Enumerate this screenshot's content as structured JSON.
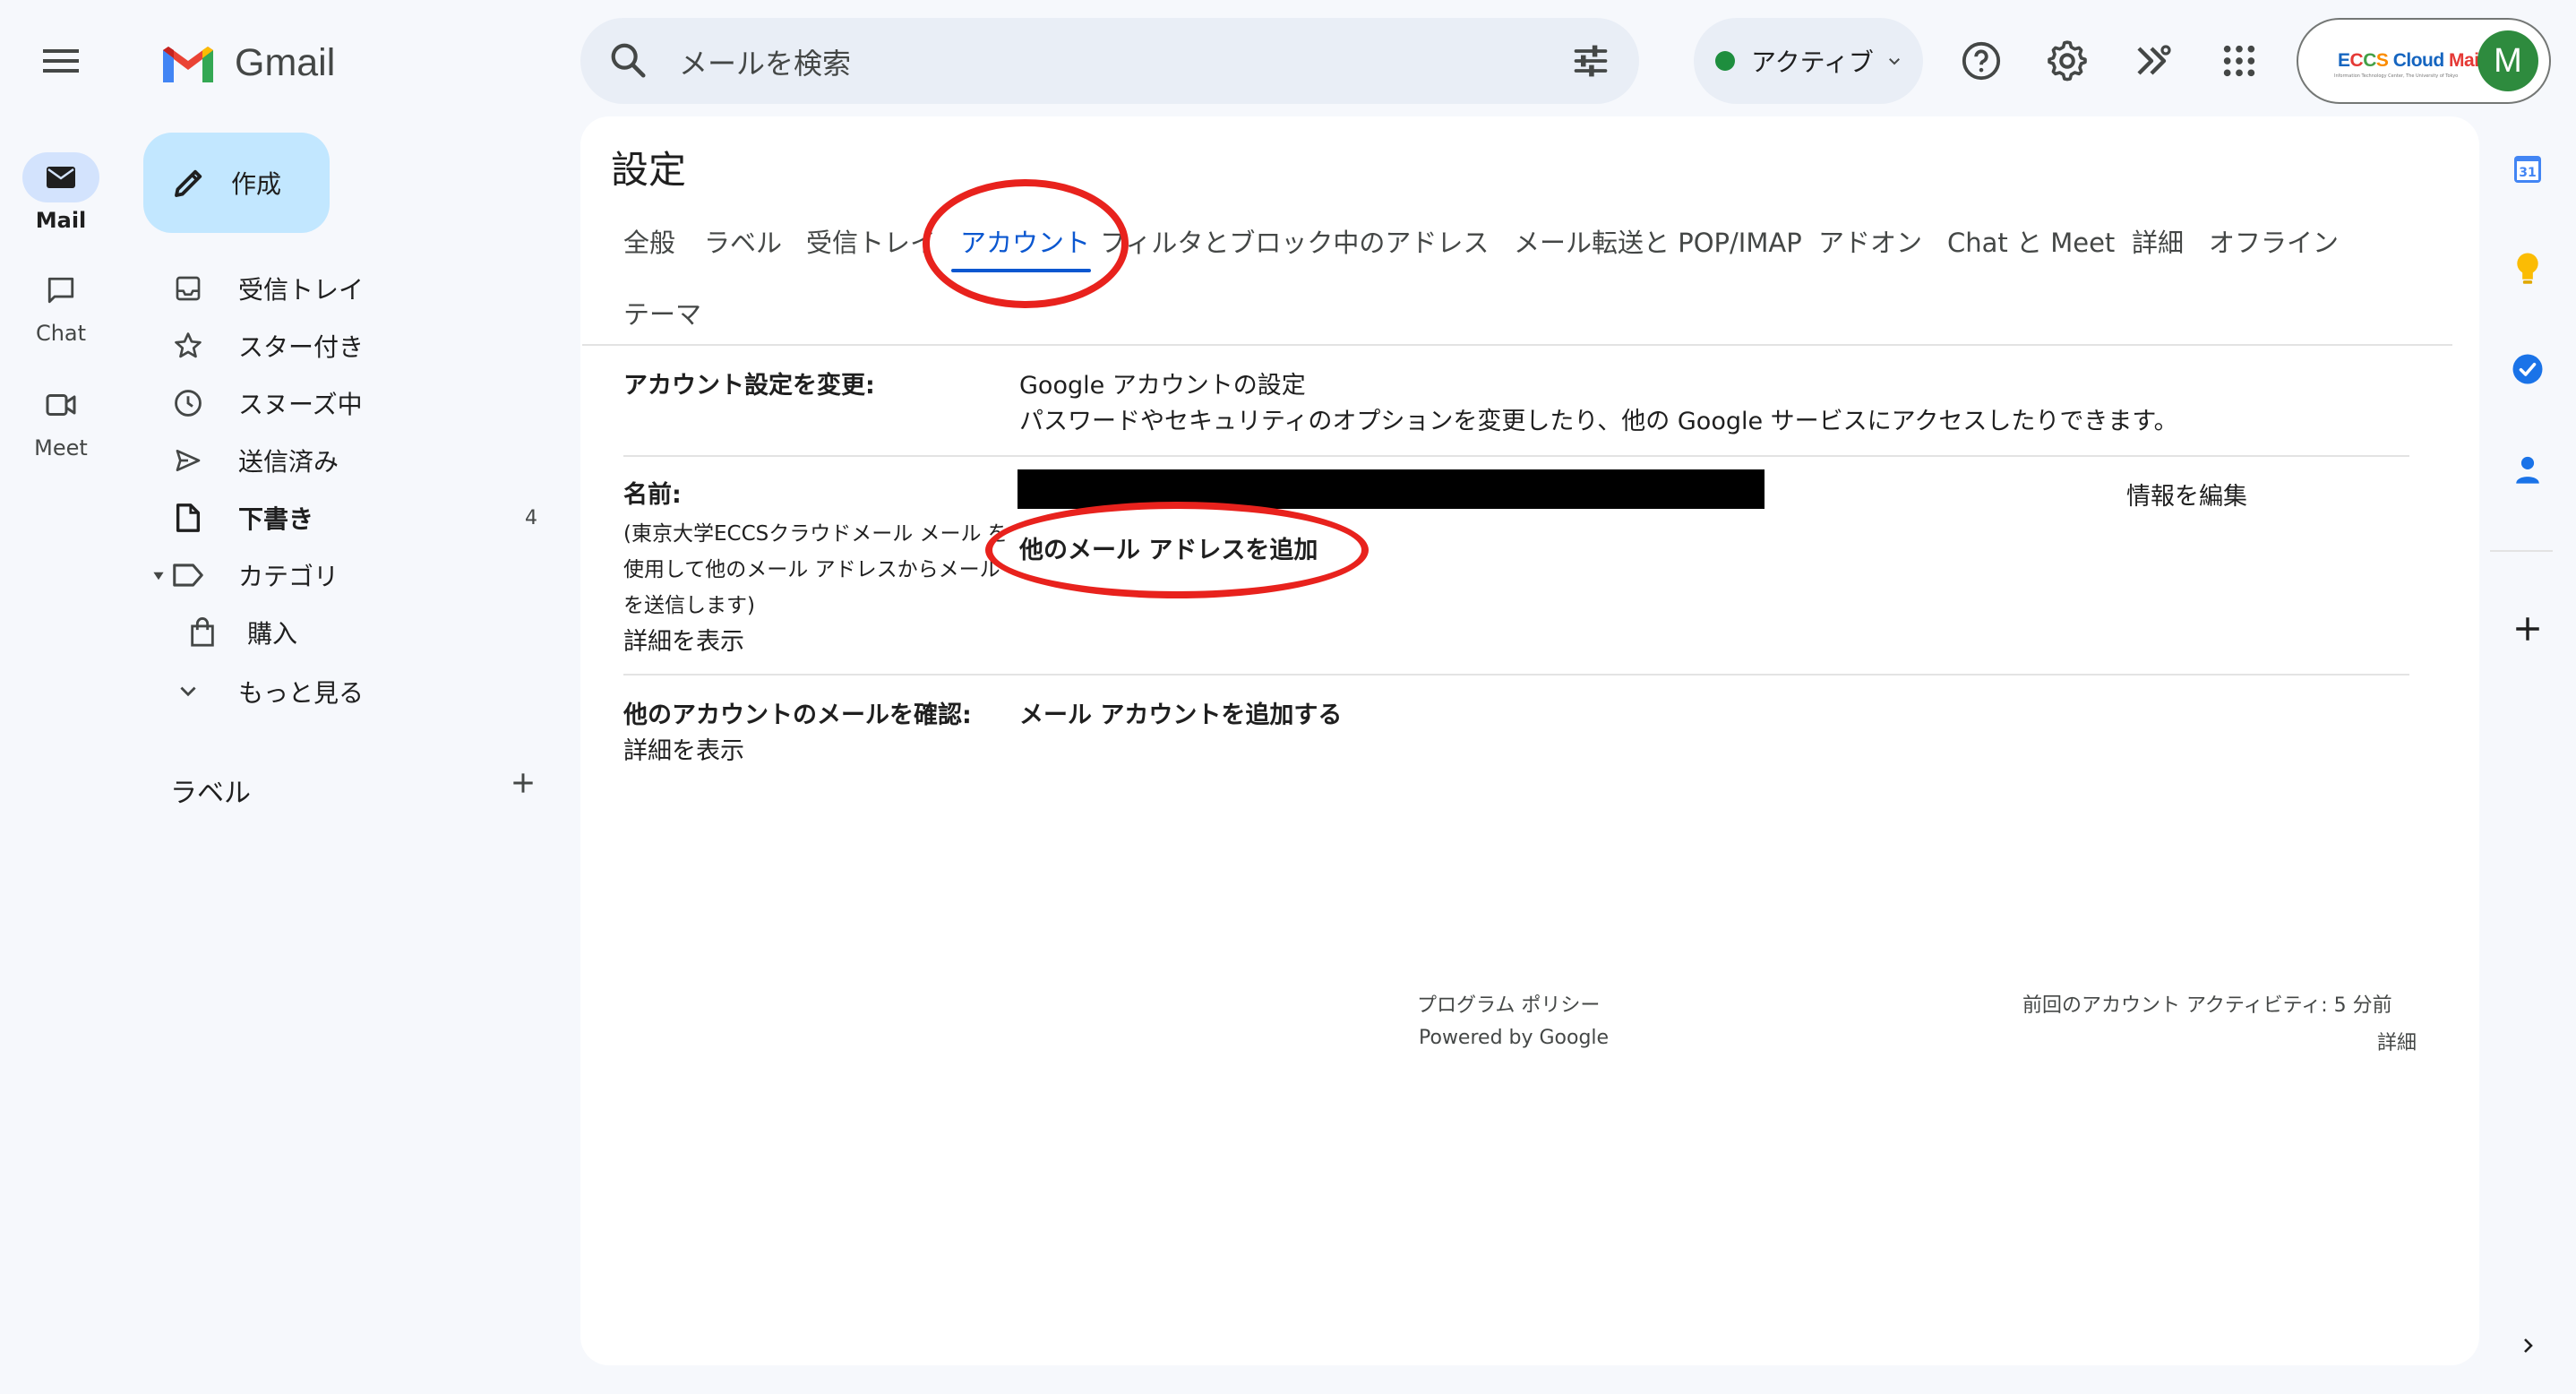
{
  "app": {
    "logo_text": "Gmail"
  },
  "search": {
    "placeholder": "メールを検索"
  },
  "status": {
    "label": "アクティブ"
  },
  "account_chip": {
    "brand_text": "ECCS Cloud Mail",
    "brand_subtext": "Information Technology Center, The University of Tokyo",
    "avatar_letter": "M"
  },
  "rail": {
    "items": [
      {
        "label": "Mail",
        "icon": "mail-icon"
      },
      {
        "label": "Chat",
        "icon": "chat-icon"
      },
      {
        "label": "Meet",
        "icon": "meet-icon"
      }
    ]
  },
  "compose": {
    "label": "作成"
  },
  "nav": {
    "items": [
      {
        "label": "受信トレイ",
        "icon": "inbox-icon"
      },
      {
        "label": "スター付き",
        "icon": "star-icon"
      },
      {
        "label": "スヌーズ中",
        "icon": "clock-icon"
      },
      {
        "label": "送信済み",
        "icon": "send-icon"
      },
      {
        "label": "下書き",
        "icon": "draft-icon",
        "count": "4"
      },
      {
        "label": "カテゴリ",
        "icon": "label-icon"
      },
      {
        "label": "購入",
        "icon": "shopping-bag-icon"
      },
      {
        "label": "もっと見る",
        "icon": "chevron-down-icon"
      }
    ],
    "labels_heading": "ラベル"
  },
  "settings": {
    "title": "設定",
    "tabs": [
      {
        "label": "全般"
      },
      {
        "label": "ラベル"
      },
      {
        "label": "受信トレイ"
      },
      {
        "label": "アカウント",
        "active": true
      },
      {
        "label": "フィルタとブロック中のアドレス"
      },
      {
        "label": "メール転送と POP/IMAP"
      },
      {
        "label": "アドオン"
      },
      {
        "label": "Chat と Meet"
      },
      {
        "label": "詳細"
      },
      {
        "label": "オフライン"
      },
      {
        "label": "テーマ"
      }
    ],
    "rows": {
      "change_account": {
        "label": "アカウント設定を変更:",
        "link": "Google アカウントの設定",
        "description": "パスワードやセキュリティのオプションを変更したり、他の Google サービスにアクセスしたりできます。"
      },
      "name": {
        "label": "名前:",
        "note_line1": "(東京大学ECCSクラウドメール メール を",
        "note_line2": "使用して他のメール アドレスからメール",
        "note_line3": "を送信します)",
        "detail_link": "詳細を表示",
        "add_address_link": "他のメール アドレスを追加",
        "edit_link": "情報を編集"
      },
      "check_mail": {
        "label": "他のアカウントのメールを確認:",
        "detail_link": "詳細を表示",
        "add_account_link": "メール アカウントを追加する"
      }
    }
  },
  "footer": {
    "policy": "プログラム ポリシー",
    "powered": "Powered by Google",
    "last_activity": "前回のアカウント アクティビティ: 5 分前",
    "details": "詳細"
  },
  "right_rail": {
    "calendar_day": "31"
  },
  "colors": {
    "accent": "#0b57d0",
    "annotation_red": "#e8221d",
    "background": "#f6f8fc"
  }
}
